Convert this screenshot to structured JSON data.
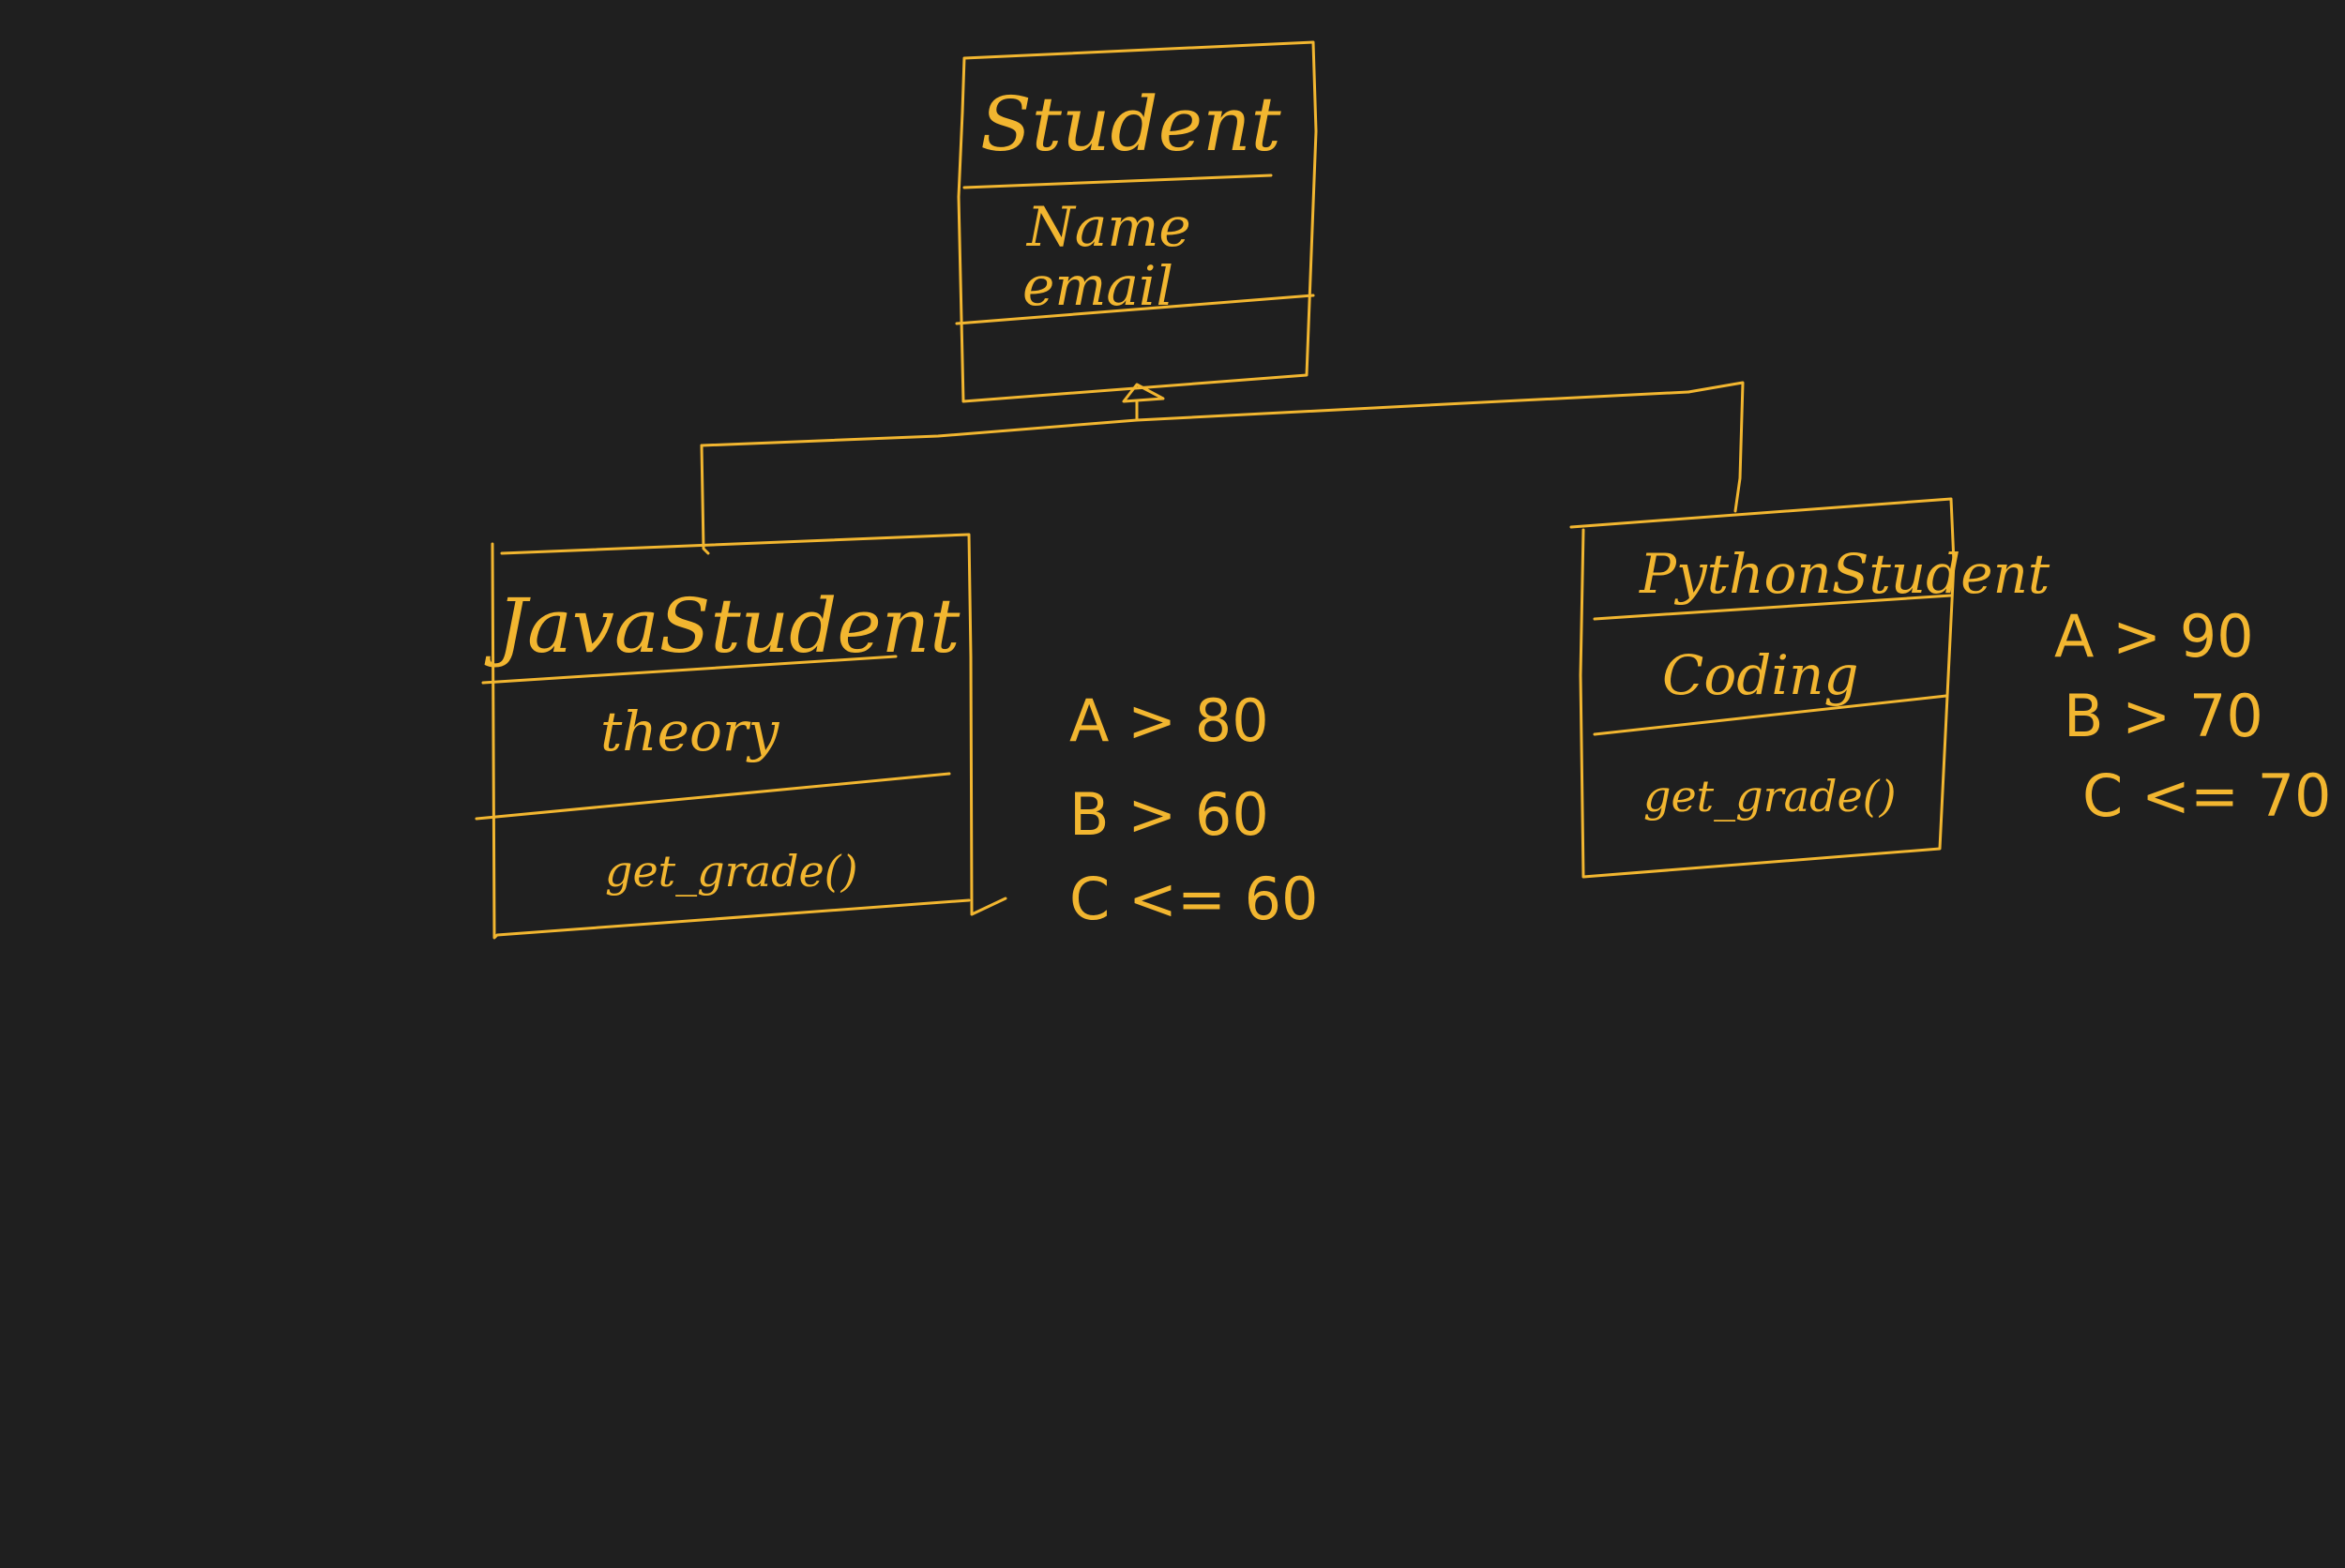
{
  "diagram": {
    "ink_color": "#f2b630",
    "background_color": "#1f1f1f",
    "classes": {
      "student": {
        "name": "Student",
        "attributes": [
          "Name",
          "email"
        ]
      },
      "java_student": {
        "name": "JavaStudent",
        "attributes": [
          "theory"
        ],
        "methods": [
          "get_grade()"
        ]
      },
      "python_student": {
        "name": "PythonStudent",
        "attributes": [
          "Coding"
        ],
        "methods": [
          "get_grade()"
        ]
      }
    },
    "notes": {
      "java_grades": [
        "A > 80",
        "B > 60",
        "C <= 60"
      ],
      "python_grades": [
        "A > 90",
        "B > 70",
        "C <= 70"
      ]
    }
  }
}
